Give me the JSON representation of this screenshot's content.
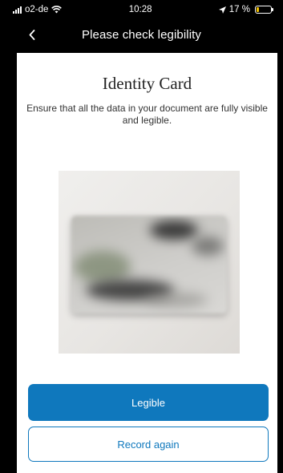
{
  "status_bar": {
    "carrier": "o2-de",
    "time": "10:28",
    "battery_percent_text": "17 %",
    "battery_level": 0.17,
    "battery_color": "#f2c100"
  },
  "nav": {
    "title": "Please check legibility",
    "back_icon": "chevron-left-icon"
  },
  "document": {
    "title": "Identity Card",
    "instructions": "Ensure that all the data in your document are fully visible and legible."
  },
  "buttons": {
    "primary_label": "Legible",
    "secondary_label": "Record again"
  },
  "colors": {
    "accent": "#0f78bd",
    "background": "#000000",
    "card": "#ffffff"
  }
}
